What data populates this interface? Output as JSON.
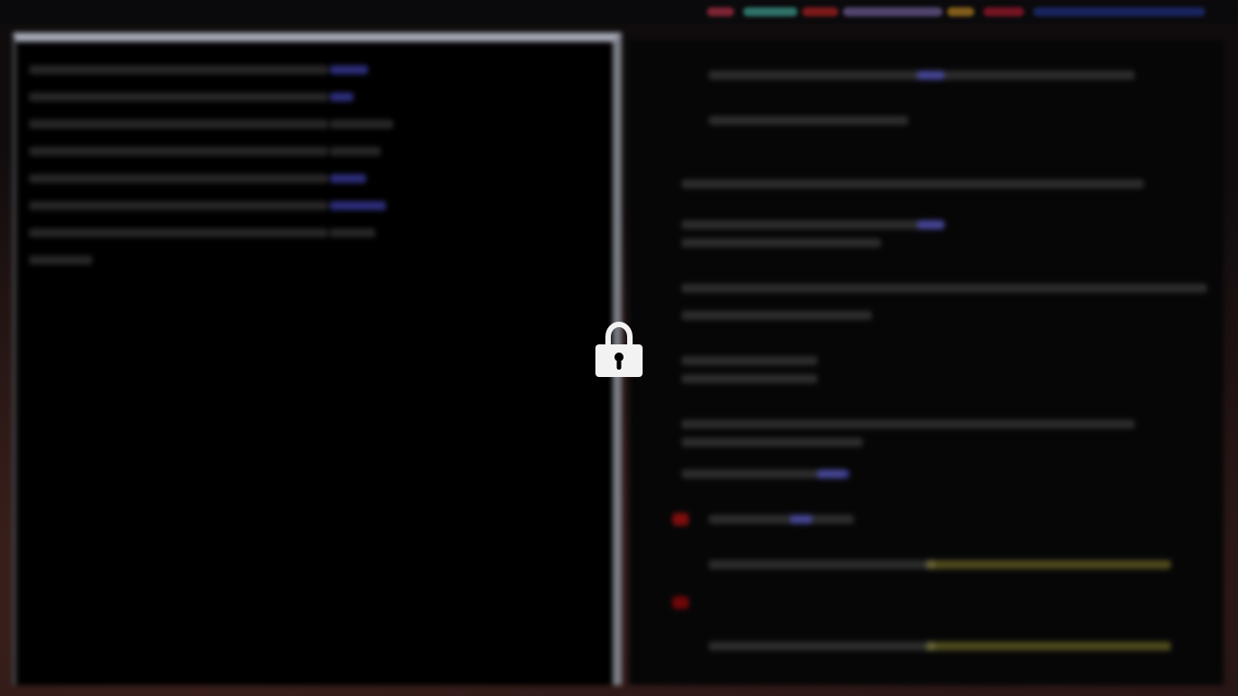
{
  "screen": {
    "state": "locked"
  },
  "lock": {
    "icon": "lock-icon",
    "color": "#f2f2f2"
  }
}
